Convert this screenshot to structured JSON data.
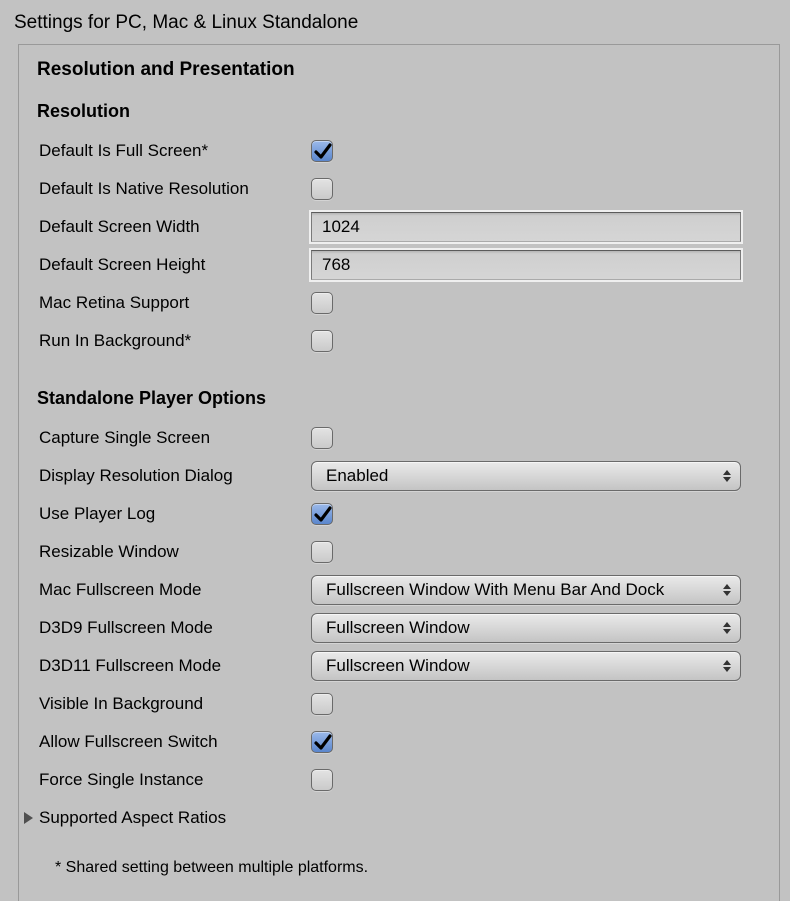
{
  "panelTitle": "Settings for PC, Mac & Linux Standalone",
  "sectionHeader": "Resolution and Presentation",
  "resolution": {
    "heading": "Resolution",
    "defaultFullscreen": {
      "label": "Default Is Full Screen*",
      "checked": true
    },
    "defaultNative": {
      "label": "Default Is Native Resolution",
      "checked": false
    },
    "defaultWidth": {
      "label": "Default Screen Width",
      "value": "1024"
    },
    "defaultHeight": {
      "label": "Default Screen Height",
      "value": "768"
    },
    "macRetina": {
      "label": "Mac Retina Support",
      "checked": false
    },
    "runInBackground": {
      "label": "Run In Background*",
      "checked": false
    }
  },
  "playerOptions": {
    "heading": "Standalone Player Options",
    "captureSingle": {
      "label": "Capture Single Screen",
      "checked": false
    },
    "displayDialog": {
      "label": "Display Resolution Dialog",
      "value": "Enabled"
    },
    "usePlayerLog": {
      "label": "Use Player Log",
      "checked": true
    },
    "resizable": {
      "label": "Resizable Window",
      "checked": false
    },
    "macFullscreenMode": {
      "label": "Mac Fullscreen Mode",
      "value": "Fullscreen Window With Menu Bar And Dock"
    },
    "d3d9": {
      "label": "D3D9 Fullscreen Mode",
      "value": "Fullscreen Window"
    },
    "d3d11": {
      "label": "D3D11 Fullscreen Mode",
      "value": "Fullscreen Window"
    },
    "visibleInBackground": {
      "label": "Visible In Background",
      "checked": false
    },
    "allowFullscreenSwitch": {
      "label": "Allow Fullscreen Switch",
      "checked": true
    },
    "forceSingleInstance": {
      "label": "Force Single Instance",
      "checked": false
    }
  },
  "aspectRatios": {
    "label": "Supported Aspect Ratios",
    "expanded": false
  },
  "footnote": "* Shared setting between multiple platforms."
}
